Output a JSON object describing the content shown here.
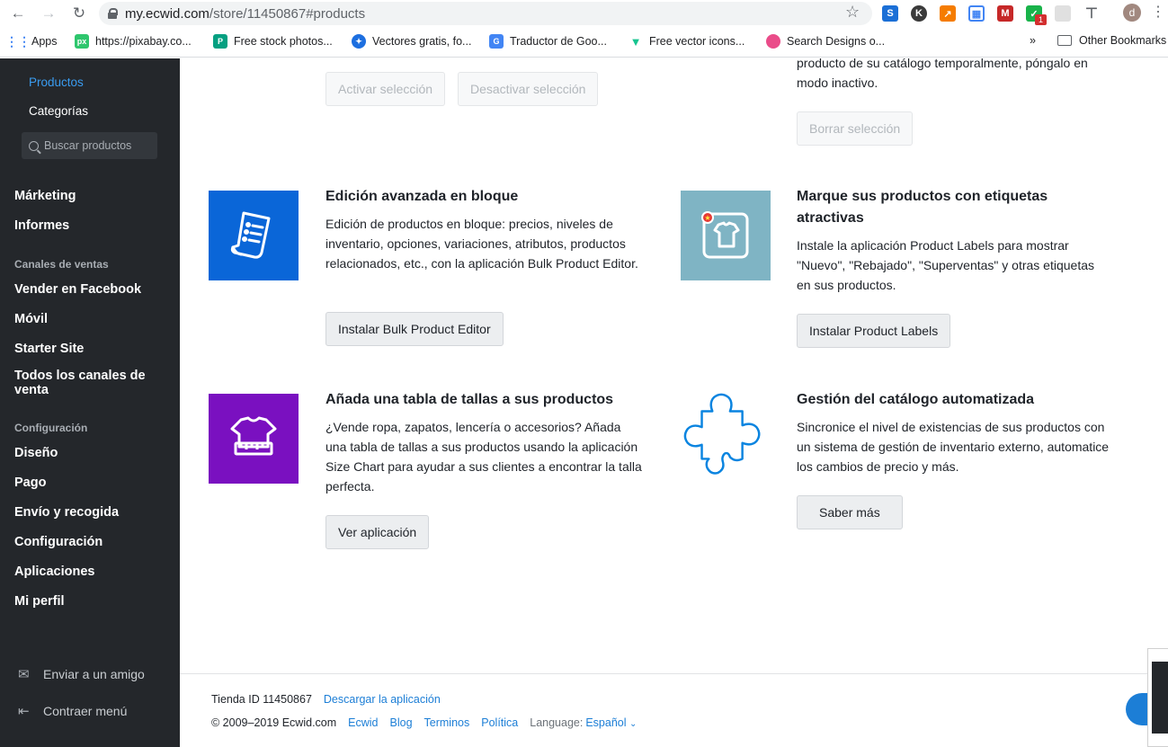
{
  "browser": {
    "url_host": "my.ecwid.com",
    "url_path": "/store/11450867#products",
    "profile_initial": "d",
    "extension_badge": "1",
    "bookmarks": [
      {
        "label": "Apps",
        "color": "#4285f4",
        "icon": "apps-grid-icon"
      },
      {
        "label": "https://pixabay.co...",
        "color": "#2ec66d",
        "icon": "pixabay-icon"
      },
      {
        "label": "Free stock photos...",
        "color": "#05a081",
        "icon": "pexels-icon"
      },
      {
        "label": "Vectores gratis, fo...",
        "color": "#1d6fe0",
        "icon": "freepik-icon"
      },
      {
        "label": "Traductor de Goo...",
        "color": "#4285f4",
        "icon": "google-translate-icon"
      },
      {
        "label": "Free vector icons...",
        "color": "#17c48f",
        "icon": "flaticon-icon"
      },
      {
        "label": "Search Designs o...",
        "color": "#ea4c89",
        "icon": "dribbble-icon"
      }
    ],
    "overflow_label": "»",
    "other_bookmarks": "Other Bookmarks"
  },
  "sidebar": {
    "sub_items": [
      {
        "label": "Productos",
        "active": true
      },
      {
        "label": "Categorías",
        "active": false
      }
    ],
    "search_placeholder": "Buscar productos",
    "items_top": [
      "Márketing",
      "Informes"
    ],
    "section_sales": "Canales de ventas",
    "items_sales": [
      "Vender en Facebook",
      "Móvil",
      "Starter Site",
      "Todos los canales de venta"
    ],
    "section_config": "Configuración",
    "items_config": [
      "Diseño",
      "Pago",
      "Envío y recogida",
      "Configuración",
      "Aplicaciones",
      "Mi perfil"
    ],
    "footer": {
      "invite": "Enviar a un amigo",
      "collapse": "Contraer menú"
    }
  },
  "main": {
    "top_left_buttons": {
      "activate": "Activar selección",
      "deactivate": "Desactivar selección"
    },
    "top_right": {
      "text": "producto de su catálogo temporalmente, póngalo en modo inactivo.",
      "delete": "Borrar selección"
    },
    "cards": [
      {
        "title": "Edición avanzada en bloque",
        "desc": "Edición de productos en bloque: precios, niveles de inventario, opciones, variaciones, atributos, productos relacionados, etc., con la aplicación Bulk Product Editor.",
        "button": "Instalar Bulk Product Editor",
        "tile_color": "#0a66d8",
        "icon": "document-list-icon"
      },
      {
        "title": "Marque sus productos con etiquetas atractivas",
        "desc": "Instale la aplicación Product Labels para mostrar \"Nuevo\", \"Rebajado\", \"Superventas\" y otras etiquetas en sus productos.",
        "button": "Instalar Product Labels",
        "tile_color": "#7fb4c4",
        "icon": "tshirt-label-icon"
      },
      {
        "title": "Añada una tabla de tallas a sus productos",
        "desc": "¿Vende ropa, zapatos, lencería o accesorios? Añada una tabla de tallas a sus productos usando la aplicación Size Chart para ayudar a sus clientes a encontrar la talla perfecta.",
        "button": "Ver aplicación",
        "tile_color": "#7a10c0",
        "icon": "tshirt-size-icon"
      },
      {
        "title": "Gestión del catálogo automatizada",
        "desc": "Sincronice el nivel de existencias de sus productos con un sistema de gestión de inventario externo, automatice los cambios de precio y más.",
        "button": "Saber más",
        "tile_color": "#ffffff",
        "icon": "puzzle-piece-icon"
      }
    ]
  },
  "footer": {
    "store_id": "Tienda ID 11450867",
    "download": "Descargar la aplicación",
    "copyright": "© 2009–2019 Ecwid.com",
    "links": [
      "Ecwid",
      "Blog",
      "Terminos",
      "Política"
    ],
    "language_label": "Language:",
    "language_value": "Español"
  }
}
